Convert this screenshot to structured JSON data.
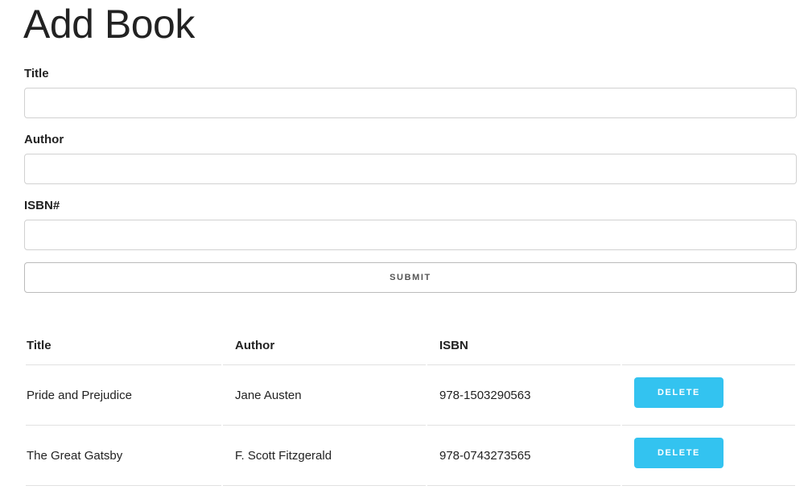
{
  "page": {
    "title": "Add Book"
  },
  "form": {
    "title_label": "Title",
    "title_value": "",
    "author_label": "Author",
    "author_value": "",
    "isbn_label": "ISBN#",
    "isbn_value": "",
    "submit_label": "SUBMIT"
  },
  "table": {
    "headers": {
      "title": "Title",
      "author": "Author",
      "isbn": "ISBN",
      "action": ""
    },
    "rows": [
      {
        "title": "Pride and Prejudice",
        "author": "Jane Austen",
        "isbn": "978-1503290563",
        "delete_label": "DELETE"
      },
      {
        "title": "The Great Gatsby",
        "author": "F. Scott Fitzgerald",
        "isbn": "978-0743273565",
        "delete_label": "DELETE"
      }
    ]
  },
  "colors": {
    "accent": "#33c3f0",
    "text": "#222222",
    "border": "#d1d1d1"
  }
}
